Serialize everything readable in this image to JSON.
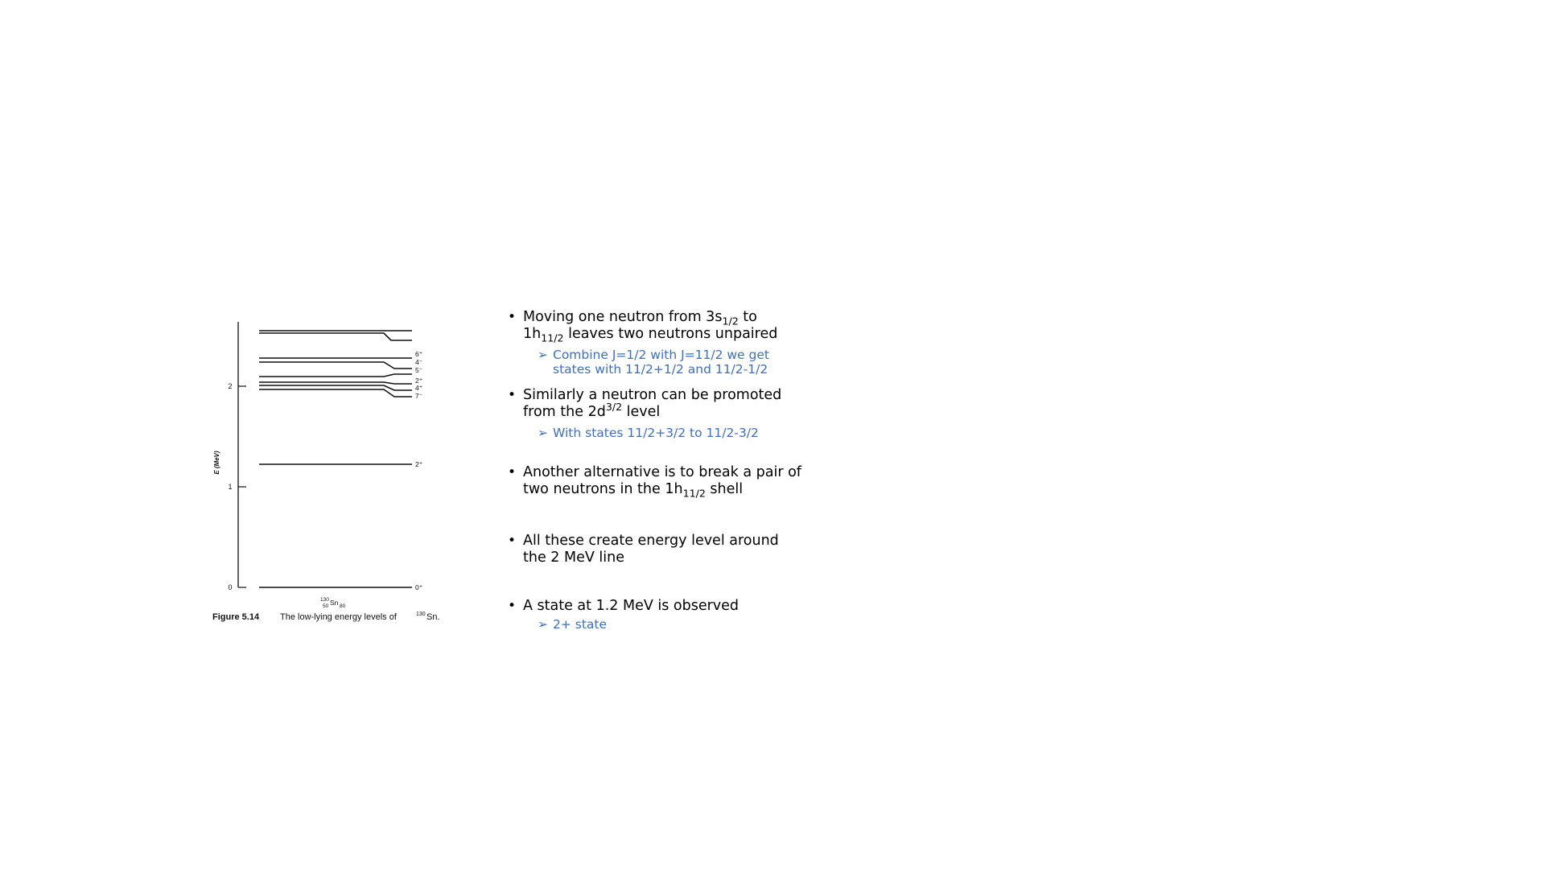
{
  "figure": {
    "axis_label": "E (MeV)",
    "y_ticks": [
      "0",
      "1",
      "2"
    ],
    "nucleus_label": {
      "mass": "130",
      "atomic": "50",
      "symbol": "Sn",
      "neutron": "80"
    },
    "caption": {
      "number": "Figure 5.14",
      "text": "The low-lying energy levels of",
      "mass": "130",
      "symbol": "Sn."
    },
    "levels": [
      {
        "energy": 0.0,
        "label": "0⁺"
      },
      {
        "energy": 1.22,
        "label": "2⁺"
      },
      {
        "energy": 1.95,
        "label": "7⁻"
      },
      {
        "energy": 1.99,
        "label": "4⁺"
      },
      {
        "energy": 2.03,
        "label": "2⁺"
      },
      {
        "energy": 2.08,
        "label": "5⁻"
      },
      {
        "energy": 2.22,
        "label": "4⁻"
      },
      {
        "energy": 2.26,
        "label": "6⁺"
      },
      {
        "energy": 2.43,
        "label": ""
      },
      {
        "energy": 2.46,
        "label": ""
      }
    ]
  },
  "bullets": [
    {
      "main": {
        "p1": "Moving one neutron from 3s",
        "s1": "1/2",
        "p2": " to",
        "p3": "1h",
        "s2": "11/2",
        "p4": " leaves two neutrons unpaired"
      },
      "subs": [
        {
          "arrow": "➢",
          "l1": "Combine J=1/2 with J=11/2 we get",
          "l2": "states with 11/2+1/2 and 11/2-1/2"
        }
      ]
    },
    {
      "main": {
        "p1": "Similarly a neutron can be promoted",
        "p2": "from the 2d",
        "s1": "3/2",
        "p3": " level"
      },
      "subs": [
        {
          "arrow": "➢",
          "l1": "With states 11/2+3/2 to 11/2-3/2"
        }
      ]
    },
    {
      "main": {
        "p1": "Another alternative is to break a pair of",
        "p2": "two neutrons in the 1h",
        "s1": "11/2",
        "p3": " shell"
      }
    },
    {
      "main": {
        "p1": "All these create energy level around",
        "p2": "the 2 MeV line"
      }
    },
    {
      "main": {
        "p1": "A state at 1.2 MeV is observed"
      },
      "subs": [
        {
          "arrow": "➢",
          "l1": "2+ state"
        }
      ]
    }
  ]
}
